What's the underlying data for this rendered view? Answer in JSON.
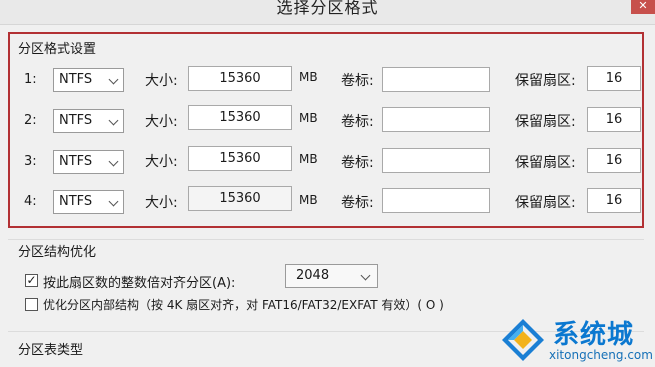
{
  "window": {
    "title": "选择分区格式",
    "close_icon": "close-icon"
  },
  "partition_settings": {
    "title": "分区格式设置",
    "size_label": "大小:",
    "unit": "MB",
    "volume_label": "卷标:",
    "reserved_label": "保留扇区:",
    "rows": [
      {
        "num": "1:",
        "fs": "NTFS",
        "size": "15360",
        "volume": "",
        "reserved": "16"
      },
      {
        "num": "2:",
        "fs": "NTFS",
        "size": "15360",
        "volume": "",
        "reserved": "16"
      },
      {
        "num": "3:",
        "fs": "NTFS",
        "size": "15360",
        "volume": "",
        "reserved": "16"
      },
      {
        "num": "4:",
        "fs": "NTFS",
        "size": "15360",
        "volume": "",
        "reserved": "16"
      }
    ]
  },
  "structure_opt": {
    "title": "分区结构优化",
    "align_label": "按此扇区数的整数倍对齐分区(A):",
    "align_checked": true,
    "align_value": "2048",
    "optimize_label": "优化分区内部结构（按 4K 扇区对齐，对 FAT16/FAT32/EXFAT 有效）( O )",
    "optimize_checked": false
  },
  "table_type": {
    "title": "分区表类型"
  },
  "watermark": {
    "brand": "系统城",
    "url": "xitongcheng.com"
  }
}
